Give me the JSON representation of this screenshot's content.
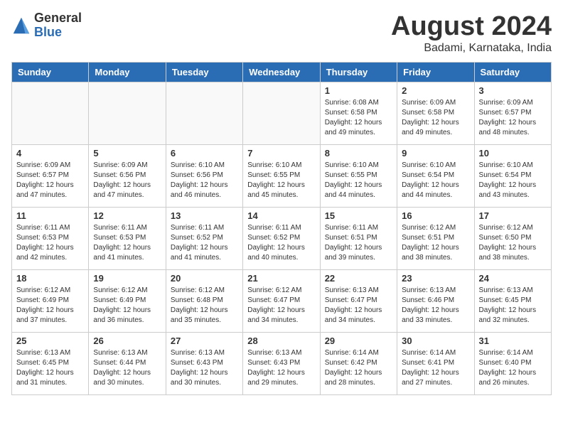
{
  "header": {
    "logo_general": "General",
    "logo_blue": "Blue",
    "month_title": "August 2024",
    "location": "Badami, Karnataka, India"
  },
  "days_of_week": [
    "Sunday",
    "Monday",
    "Tuesday",
    "Wednesday",
    "Thursday",
    "Friday",
    "Saturday"
  ],
  "weeks": [
    [
      {
        "num": "",
        "info": ""
      },
      {
        "num": "",
        "info": ""
      },
      {
        "num": "",
        "info": ""
      },
      {
        "num": "",
        "info": ""
      },
      {
        "num": "1",
        "info": "Sunrise: 6:08 AM\nSunset: 6:58 PM\nDaylight: 12 hours\nand 49 minutes."
      },
      {
        "num": "2",
        "info": "Sunrise: 6:09 AM\nSunset: 6:58 PM\nDaylight: 12 hours\nand 49 minutes."
      },
      {
        "num": "3",
        "info": "Sunrise: 6:09 AM\nSunset: 6:57 PM\nDaylight: 12 hours\nand 48 minutes."
      }
    ],
    [
      {
        "num": "4",
        "info": "Sunrise: 6:09 AM\nSunset: 6:57 PM\nDaylight: 12 hours\nand 47 minutes."
      },
      {
        "num": "5",
        "info": "Sunrise: 6:09 AM\nSunset: 6:56 PM\nDaylight: 12 hours\nand 47 minutes."
      },
      {
        "num": "6",
        "info": "Sunrise: 6:10 AM\nSunset: 6:56 PM\nDaylight: 12 hours\nand 46 minutes."
      },
      {
        "num": "7",
        "info": "Sunrise: 6:10 AM\nSunset: 6:55 PM\nDaylight: 12 hours\nand 45 minutes."
      },
      {
        "num": "8",
        "info": "Sunrise: 6:10 AM\nSunset: 6:55 PM\nDaylight: 12 hours\nand 44 minutes."
      },
      {
        "num": "9",
        "info": "Sunrise: 6:10 AM\nSunset: 6:54 PM\nDaylight: 12 hours\nand 44 minutes."
      },
      {
        "num": "10",
        "info": "Sunrise: 6:10 AM\nSunset: 6:54 PM\nDaylight: 12 hours\nand 43 minutes."
      }
    ],
    [
      {
        "num": "11",
        "info": "Sunrise: 6:11 AM\nSunset: 6:53 PM\nDaylight: 12 hours\nand 42 minutes."
      },
      {
        "num": "12",
        "info": "Sunrise: 6:11 AM\nSunset: 6:53 PM\nDaylight: 12 hours\nand 41 minutes."
      },
      {
        "num": "13",
        "info": "Sunrise: 6:11 AM\nSunset: 6:52 PM\nDaylight: 12 hours\nand 41 minutes."
      },
      {
        "num": "14",
        "info": "Sunrise: 6:11 AM\nSunset: 6:52 PM\nDaylight: 12 hours\nand 40 minutes."
      },
      {
        "num": "15",
        "info": "Sunrise: 6:11 AM\nSunset: 6:51 PM\nDaylight: 12 hours\nand 39 minutes."
      },
      {
        "num": "16",
        "info": "Sunrise: 6:12 AM\nSunset: 6:51 PM\nDaylight: 12 hours\nand 38 minutes."
      },
      {
        "num": "17",
        "info": "Sunrise: 6:12 AM\nSunset: 6:50 PM\nDaylight: 12 hours\nand 38 minutes."
      }
    ],
    [
      {
        "num": "18",
        "info": "Sunrise: 6:12 AM\nSunset: 6:49 PM\nDaylight: 12 hours\nand 37 minutes."
      },
      {
        "num": "19",
        "info": "Sunrise: 6:12 AM\nSunset: 6:49 PM\nDaylight: 12 hours\nand 36 minutes."
      },
      {
        "num": "20",
        "info": "Sunrise: 6:12 AM\nSunset: 6:48 PM\nDaylight: 12 hours\nand 35 minutes."
      },
      {
        "num": "21",
        "info": "Sunrise: 6:12 AM\nSunset: 6:47 PM\nDaylight: 12 hours\nand 34 minutes."
      },
      {
        "num": "22",
        "info": "Sunrise: 6:13 AM\nSunset: 6:47 PM\nDaylight: 12 hours\nand 34 minutes."
      },
      {
        "num": "23",
        "info": "Sunrise: 6:13 AM\nSunset: 6:46 PM\nDaylight: 12 hours\nand 33 minutes."
      },
      {
        "num": "24",
        "info": "Sunrise: 6:13 AM\nSunset: 6:45 PM\nDaylight: 12 hours\nand 32 minutes."
      }
    ],
    [
      {
        "num": "25",
        "info": "Sunrise: 6:13 AM\nSunset: 6:45 PM\nDaylight: 12 hours\nand 31 minutes."
      },
      {
        "num": "26",
        "info": "Sunrise: 6:13 AM\nSunset: 6:44 PM\nDaylight: 12 hours\nand 30 minutes."
      },
      {
        "num": "27",
        "info": "Sunrise: 6:13 AM\nSunset: 6:43 PM\nDaylight: 12 hours\nand 30 minutes."
      },
      {
        "num": "28",
        "info": "Sunrise: 6:13 AM\nSunset: 6:43 PM\nDaylight: 12 hours\nand 29 minutes."
      },
      {
        "num": "29",
        "info": "Sunrise: 6:14 AM\nSunset: 6:42 PM\nDaylight: 12 hours\nand 28 minutes."
      },
      {
        "num": "30",
        "info": "Sunrise: 6:14 AM\nSunset: 6:41 PM\nDaylight: 12 hours\nand 27 minutes."
      },
      {
        "num": "31",
        "info": "Sunrise: 6:14 AM\nSunset: 6:40 PM\nDaylight: 12 hours\nand 26 minutes."
      }
    ]
  ]
}
